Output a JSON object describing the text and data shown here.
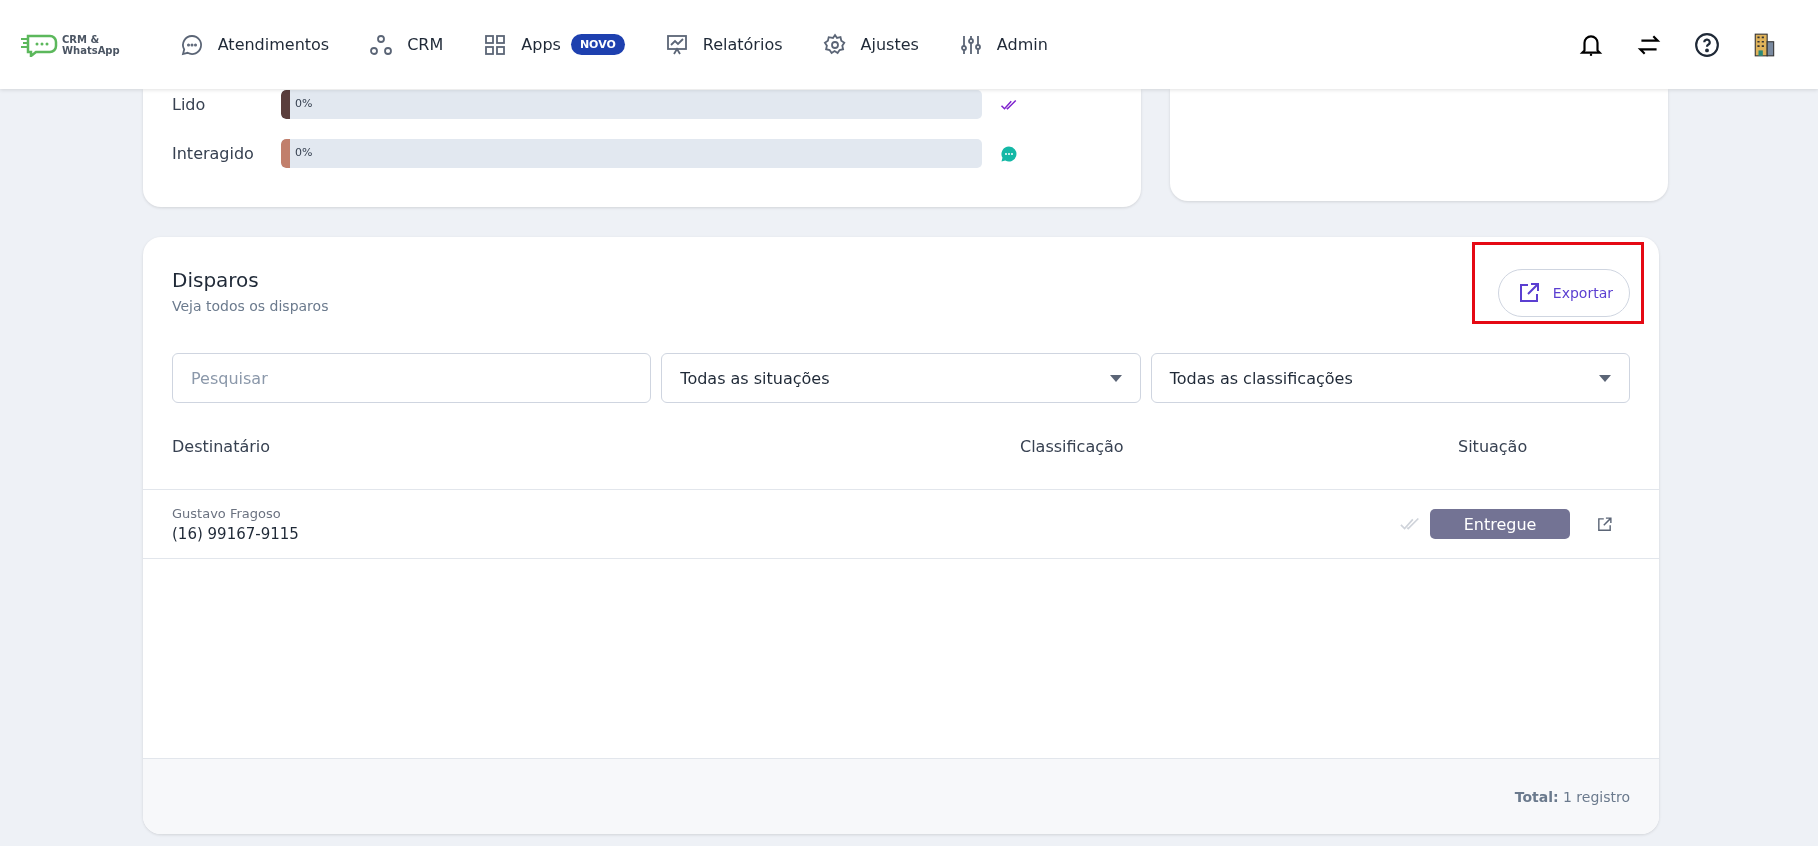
{
  "logo": {
    "line1": "CRM &",
    "line2": "WhatsApp"
  },
  "nav": [
    {
      "label": "Atendimentos"
    },
    {
      "label": "CRM"
    },
    {
      "label": "Apps",
      "badge": "NOVO"
    },
    {
      "label": "Relatórios"
    },
    {
      "label": "Ajustes"
    },
    {
      "label": "Admin"
    }
  ],
  "progress": [
    {
      "label": "Lido",
      "reading": "0%",
      "level": 0,
      "color": "#5a3e3c"
    },
    {
      "label": "Interagido",
      "reading": "0%",
      "level": 0,
      "color": "#c17f6c"
    }
  ],
  "disparos": {
    "title": "Disparos",
    "subtitle": "Veja todos os disparos",
    "export_button": "Exportar",
    "search": {
      "placeholder": "Pesquisar"
    },
    "filters": [
      "Todas as situações",
      "Todas as classificações"
    ],
    "columns": [
      "Destinatário",
      "Classificação",
      "Situação"
    ],
    "rows": [
      {
        "name": "Gustavo Fragoso",
        "phone": "(16) 99167-9115",
        "status": "Entregue",
        "read": false
      }
    ],
    "total": "**Total:** 1 registro"
  }
}
